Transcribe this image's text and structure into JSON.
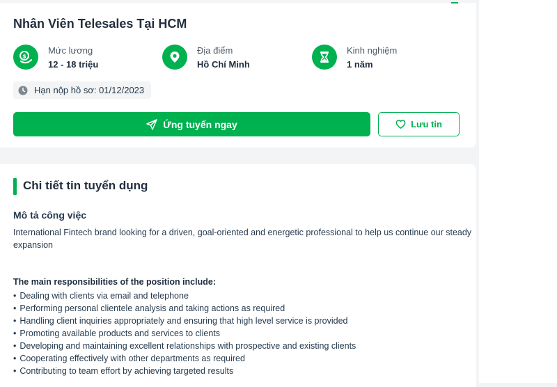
{
  "job": {
    "title": "Nhân Viên Telesales Tại HCM",
    "salary": {
      "label": "Mức lương",
      "value": "12 - 18 triệu",
      "icon": "money-icon"
    },
    "location": {
      "label": "Địa điểm",
      "value": "Hồ Chí Minh",
      "icon": "location-pin-icon"
    },
    "experience": {
      "label": "Kinh nghiệm",
      "value": "1 năm",
      "icon": "hourglass-icon"
    },
    "deadline": "Hạn nộp hồ sơ: 01/12/2023"
  },
  "actions": {
    "apply_label": "Ứng tuyển ngay",
    "save_label": "Lưu tin"
  },
  "details": {
    "section_title": "Chi tiết tin tuyển dụng",
    "description_heading": "Mô tả công việc",
    "description": "International Fintech brand looking for a driven, goal-oriented and energetic professional to help us continue our steady expansion",
    "responsibilities_heading": "The main responsibilities of the position include:",
    "responsibilities": [
      "Dealing with clients via email and telephone",
      "Performing personal clientele analysis and taking actions as required",
      "Handling client inquiries appropriately and ensuring that high level service is provided",
      "Promoting available products and services to clients",
      "Developing and maintaining excellent relationships with prospective and existing clients",
      "Cooperating effectively with other departments as required",
      "Contributing to team effort by achieving targeted results"
    ]
  },
  "colors": {
    "accent": "#00b14f",
    "text_dark": "#212f3f",
    "background": "#f2f4f5"
  }
}
